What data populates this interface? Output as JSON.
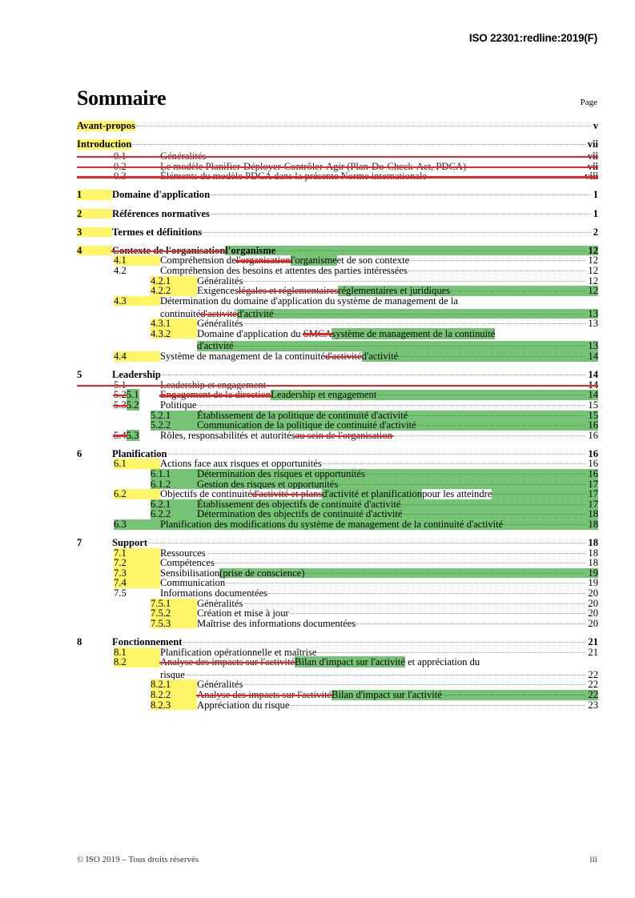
{
  "header": {
    "doc_ref": "ISO 22301:redline:2019(F)"
  },
  "title": {
    "heading": "Sommaire",
    "page_label": "Page"
  },
  "toc": {
    "entries": [
      {
        "num": "",
        "text": "Avant-propos",
        "page": "v"
      },
      {
        "num": "",
        "text": "Introduction",
        "page": "vii"
      },
      {
        "num": "0.1",
        "text": "Généralités",
        "page": "vii"
      },
      {
        "num": "0.2",
        "text": "Le modèle Planifier-Déployer-Contrôler-Agir (Plan-Do-Check-Act, PDCA)",
        "page": "vii"
      },
      {
        "num": "0.3",
        "text": "Éléments du modèle PDCA dans la présente Norme internationale",
        "page": "viii"
      },
      {
        "num": "1",
        "text": "Domaine d'application",
        "page": "1"
      },
      {
        "num": "2",
        "text": "Références normatives",
        "page": "1"
      },
      {
        "num": "3",
        "text": "Termes et définitions",
        "page": "2"
      },
      {
        "num": "4",
        "text_del": "Contexte de l'organisation",
        "text_ins": "l'organisme",
        "page": "12"
      },
      {
        "num": "4.1",
        "text_a": "Compréhension de ",
        "text_del": "l'organisation",
        "text_ins": "l'organisme",
        "text_b": " et de son contexte",
        "page": "12"
      },
      {
        "num": "4.2",
        "text": "Compréhension des besoins et attentes des parties intéressées",
        "page": "12"
      },
      {
        "num": "4.2.1",
        "text": "Généralités",
        "page": "12"
      },
      {
        "num": "4.2.2",
        "text_a": "Exigences ",
        "text_del": "légales et réglementaires",
        "text_ins": "réglementaires et juridiques",
        "page": "12"
      },
      {
        "num": "4.3",
        "text_line1": "Détermination du domaine d'application du système de management de la",
        "text_line2_a": "continuité ",
        "text_line2_del": "d'activité",
        "text_line2_ins": "d'activité",
        "page": "13"
      },
      {
        "num": "4.3.1",
        "text": "Généralités",
        "page": "13"
      },
      {
        "num": "4.3.2",
        "text_a": "Domaine d'application du ",
        "text_del": "SMCA",
        "text_ins_line1": "système de management de la continuité",
        "text_ins_line2": "d'activité",
        "page": "13"
      },
      {
        "num": "4.4",
        "text_a": "Système de management de la continuité ",
        "text_del": "d'activité",
        "text_ins": "d'activité",
        "page": "14"
      },
      {
        "num": "5",
        "text": "Leadership",
        "page": "14"
      },
      {
        "num": "5.1",
        "text": "Leadership et engagement",
        "page": "14",
        "all_deleted": true
      },
      {
        "num_del": "5.2",
        "num_ins": "5.1",
        "text_del": "Engagement de la direction",
        "text_ins": "Leadership et engagement",
        "page": "14"
      },
      {
        "num_del": "5.3",
        "num_ins": "5.2",
        "text": "Politique",
        "page": "15"
      },
      {
        "num": "5.2.1",
        "text": "Établissement de la politique de continuité d'activité",
        "page": "15"
      },
      {
        "num": "5.2.2",
        "text": "Communication de la politique de continuité d'activité",
        "page": "16"
      },
      {
        "num_del": "5.4",
        "num_ins": "5.3",
        "text_a": "Rôles, responsabilités et autorités",
        "text_del": " au sein de l'organisation",
        "page": "16"
      },
      {
        "num": "6",
        "text": "Planification",
        "page": "16"
      },
      {
        "num": "6.1",
        "text": "Actions face aux risques et opportunités",
        "page": "16"
      },
      {
        "num": "6.1.1",
        "text": "Détermination des risques et opportunités",
        "page": "16"
      },
      {
        "num": "6.1.2",
        "text": "Gestion des risques et opportunités",
        "page": "17"
      },
      {
        "num": "6.2",
        "text_a": "Objectifs de continuité ",
        "text_del": "d'activité et plans",
        "text_ins": "d'activité et planification",
        "text_b": " pour les atteindre",
        "page": "17"
      },
      {
        "num": "6.2.1",
        "text": "Établissement des objectifs de continuité d'activité",
        "page": "17"
      },
      {
        "num": "6.2.2",
        "text": "Détermination des objectifs de continuité d'activité",
        "page": "18"
      },
      {
        "num": "6.3",
        "text": "Planification des modifications du système de management de la continuité d'activité",
        "page": "18"
      },
      {
        "num": "7",
        "text": "Support",
        "page": "18"
      },
      {
        "num": "7.1",
        "text": "Ressources",
        "page": "18"
      },
      {
        "num": "7.2",
        "text": "Compétences",
        "page": "18"
      },
      {
        "num": "7.3",
        "text_a": "Sensibilisation ",
        "text_ins": "(prise de conscience)",
        "page": "19"
      },
      {
        "num": "7.4",
        "text": "Communication",
        "page": "19"
      },
      {
        "num": "7.5",
        "text": "Informations documentées",
        "page": "20"
      },
      {
        "num": "7.5.1",
        "text": "Généralités",
        "page": "20"
      },
      {
        "num": "7.5.2",
        "text": "Création et mise à jour",
        "page": "20"
      },
      {
        "num": "7.5.3",
        "text": "Maîtrise des informations documentées",
        "page": "20"
      },
      {
        "num": "8",
        "text": "Fonctionnement",
        "page": "21"
      },
      {
        "num": "8.1",
        "text": "Planification opérationnelle et maîtrise",
        "page": "21"
      },
      {
        "num": "8.2",
        "text_del": "Analyse des impacts sur l'activité",
        "text_ins": "Bilan d'impact sur l'activité",
        "text_b": " et appréciation du",
        "text_line2": "risque",
        "page": "22"
      },
      {
        "num": "8.2.1",
        "text": "Généralités",
        "page": "22"
      },
      {
        "num": "8.2.2",
        "text_del": "Analyse des impacts sur l'activité",
        "text_ins": "Bilan d'impact sur l'activité",
        "page": "22"
      },
      {
        "num": "8.2.3",
        "text": "Appréciation du risque",
        "page": "23"
      }
    ]
  },
  "footer": {
    "copyright": "© ISO 2019 – Tous droits réservés",
    "page_number": "iii"
  },
  "colors": {
    "insert_highlight": "#76c376",
    "delete_stroke": "#ee2222",
    "change_bar_highlight": "#fff566"
  }
}
